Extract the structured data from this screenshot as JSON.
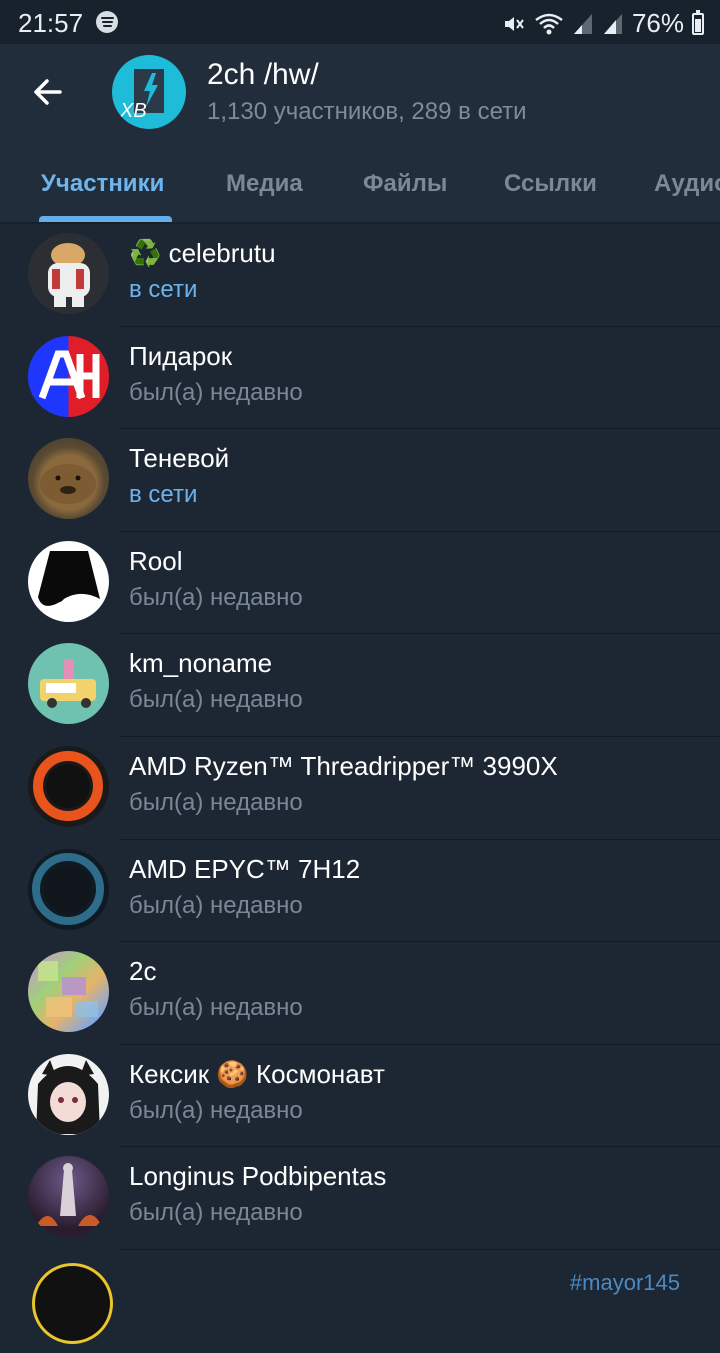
{
  "status_bar": {
    "time": "21:57",
    "battery": "76%"
  },
  "header": {
    "title": "2ch /hw/",
    "subtitle": "1,130 участников, 289 в сети",
    "avatar_text": "XB",
    "back_icon": "arrow-left-icon"
  },
  "tabs": [
    {
      "label": "Участники",
      "active": true
    },
    {
      "label": "Медиа",
      "active": false
    },
    {
      "label": "Файлы",
      "active": false
    },
    {
      "label": "Ссылки",
      "active": false
    },
    {
      "label": "Аудио",
      "active": false
    }
  ],
  "members": [
    {
      "name": "♻️ celebrutu",
      "status": "в сети",
      "online": true
    },
    {
      "name": "Пидарок",
      "status": "был(а) недавно",
      "online": false
    },
    {
      "name": "Теневой",
      "status": "в сети",
      "online": true
    },
    {
      "name": "Rool",
      "status": "был(а) недавно",
      "online": false
    },
    {
      "name": "km_noname",
      "status": "был(а) недавно",
      "online": false
    },
    {
      "name": "AMD Ryzen™ Threadripper™ 3990X",
      "status": "был(а) недавно",
      "online": false
    },
    {
      "name": "AMD EPYC™ 7H12",
      "status": "был(а) недавно",
      "online": false
    },
    {
      "name": "2c",
      "status": "был(а) недавно",
      "online": false
    },
    {
      "name": "Кексик 🍪 Космонавт",
      "status": "был(а) недавно",
      "online": false
    },
    {
      "name": "Longinus Podbipentas",
      "status": "был(а) недавно",
      "online": false
    },
    {
      "name": "",
      "status": "",
      "online": false,
      "tag": "#mayor145"
    }
  ],
  "colors": {
    "background": "#1d2733",
    "header": "#212d3b",
    "accent": "#6fb5ec",
    "muted": "#7a8795"
  }
}
